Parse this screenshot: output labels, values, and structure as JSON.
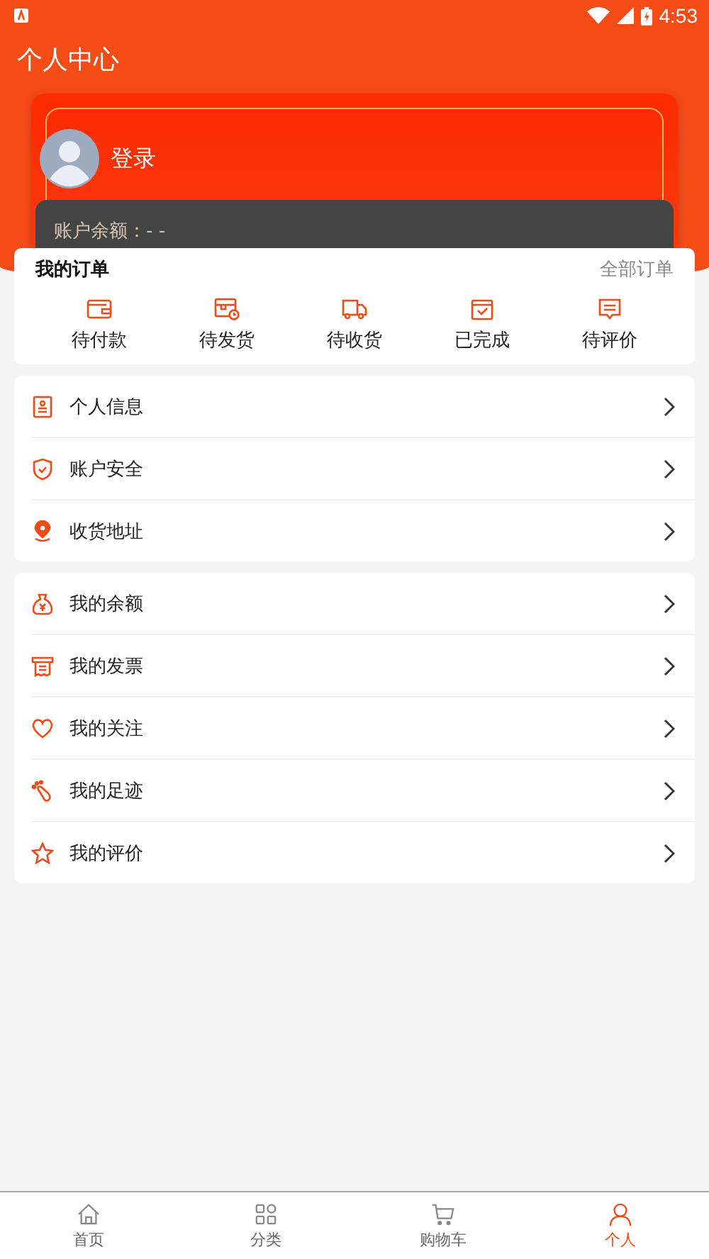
{
  "status_bar": {
    "time": "4:53"
  },
  "header": {
    "title": "个人中心"
  },
  "profile": {
    "login_label": "登录",
    "balance_label": "账户余额：- -"
  },
  "orders": {
    "title": "我的订单",
    "all_link": "全部订单",
    "items": [
      {
        "label": "待付款"
      },
      {
        "label": "待发货"
      },
      {
        "label": "待收货"
      },
      {
        "label": "已完成"
      },
      {
        "label": "待评价"
      }
    ]
  },
  "menu_groups": [
    {
      "items": [
        {
          "label": "个人信息"
        },
        {
          "label": "账户安全"
        },
        {
          "label": "收货地址"
        }
      ]
    },
    {
      "items": [
        {
          "label": "我的余额"
        },
        {
          "label": "我的发票"
        },
        {
          "label": "我的关注"
        },
        {
          "label": "我的足迹"
        },
        {
          "label": "我的评价"
        }
      ]
    }
  ],
  "tab_bar": [
    {
      "label": "首页",
      "selected": false
    },
    {
      "label": "分类",
      "selected": false
    },
    {
      "label": "购物车",
      "selected": false
    },
    {
      "label": "个人",
      "selected": true
    }
  ]
}
